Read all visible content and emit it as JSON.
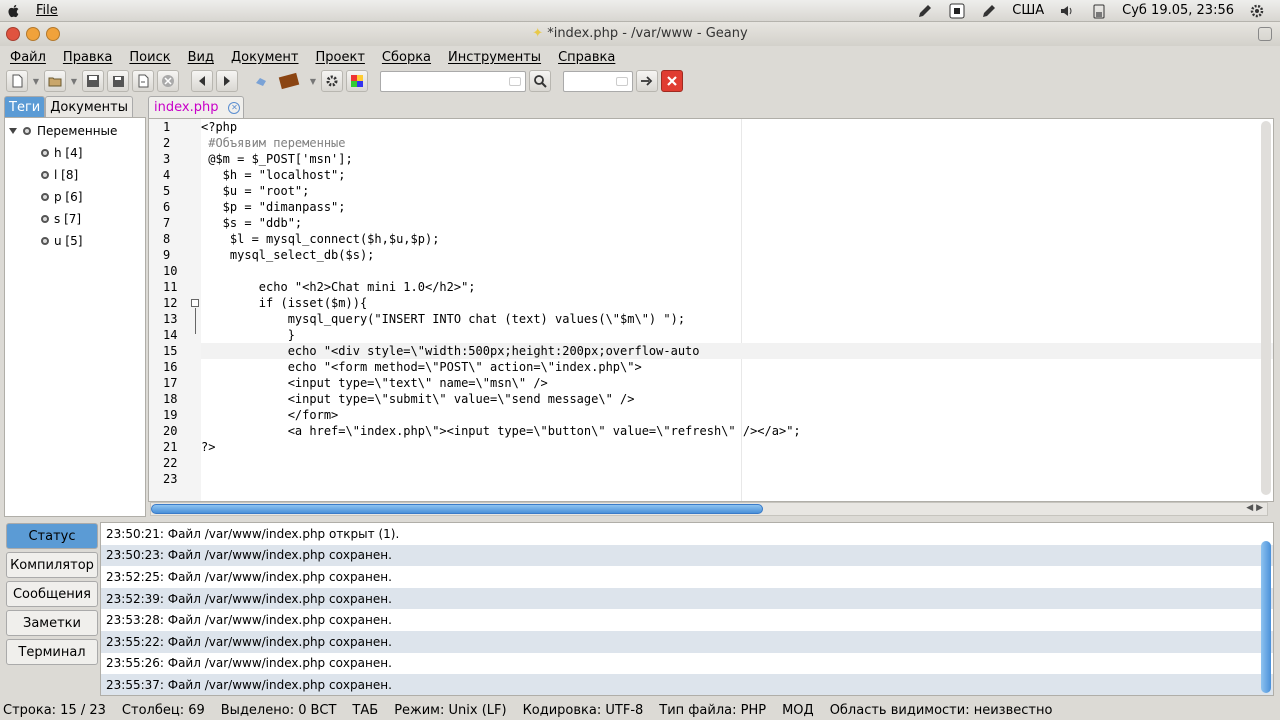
{
  "top_panel": {
    "app_menu": "File",
    "keyboard_layout": "США",
    "clock": "Суб 19.05, 23:56"
  },
  "window": {
    "title": "*index.php - /var/www - Geany"
  },
  "menu": {
    "items": [
      "Файл",
      "Правка",
      "Поиск",
      "Вид",
      "Документ",
      "Проект",
      "Сборка",
      "Инструменты",
      "Справка"
    ]
  },
  "sidebar": {
    "tabs": [
      "Теги",
      "Документы"
    ],
    "tree_root": "Переменные",
    "tree_items": [
      "h [4]",
      "l [8]",
      "p [6]",
      "s [7]",
      "u [5]"
    ]
  },
  "editor": {
    "tab_name": "index.php",
    "line_numbers": [
      "1",
      "2",
      "3",
      "4",
      "5",
      "6",
      "7",
      "8",
      "9",
      "10",
      "11",
      "12",
      "13",
      "14",
      "15",
      "16",
      "17",
      "18",
      "19",
      "20",
      "21",
      "22",
      "23"
    ],
    "lines": [
      "<?php",
      " #Объявим переменные",
      " @$m = $_POST['msn'];",
      "   $h = \"localhost\";",
      "   $u = \"root\";",
      "   $p = \"dimanpass\";",
      "   $s = \"ddb\";",
      "    $l = mysql_connect($h,$u,$p);",
      "    mysql_select_db($s);",
      "",
      "        echo \"<h2>Chat mini 1.0</h2>\";",
      "        if (isset($m)){",
      "            mysql_query(\"INSERT INTO chat (text) values(\\\"$m\\\") \");",
      "            }",
      "            echo \"<div style=\\\"width:500px;height:200px;overflow-auto",
      "            echo \"<form method=\\\"POST\\\" action=\\\"index.php\\\">",
      "            <input type=\\\"text\\\" name=\\\"msn\\\" />",
      "            <input type=\\\"submit\\\" value=\\\"send message\\\" />",
      "            </form>",
      "            <a href=\\\"index.php\\\"><input type=\\\"button\\\" value=\\\"refresh\\\" /></a>\";",
      "?>",
      "",
      ""
    ]
  },
  "messages": {
    "tabs": [
      "Статус",
      "Компилятор",
      "Сообщения",
      "Заметки",
      "Терминал"
    ],
    "rows": [
      "23:50:21: Файл /var/www/index.php открыт (1).",
      "23:50:23: Файл /var/www/index.php сохранен.",
      "23:52:25: Файл /var/www/index.php сохранен.",
      "23:52:39: Файл /var/www/index.php сохранен.",
      "23:53:28: Файл /var/www/index.php сохранен.",
      "23:55:22: Файл /var/www/index.php сохранен.",
      "23:55:26: Файл /var/www/index.php сохранен.",
      "23:55:37: Файл /var/www/index.php сохранен."
    ]
  },
  "status": {
    "line": "Строка: 15 / 23",
    "column": "Столбец: 69",
    "selected": "Выделено: 0",
    "insert_mode": "ВСТ",
    "indent": "ТАБ",
    "mode": "Режим: Unix (LF)",
    "encoding": "Кодировка: UTF-8",
    "filetype": "Тип файла: PHP",
    "modified": "МОД",
    "scope": "Область видимости: неизвестно"
  },
  "colors": {
    "accent": "#5b9bd5",
    "string": "#008000",
    "comment": "#808080",
    "tab_name": "#c800c8",
    "close": "#e03c31"
  }
}
